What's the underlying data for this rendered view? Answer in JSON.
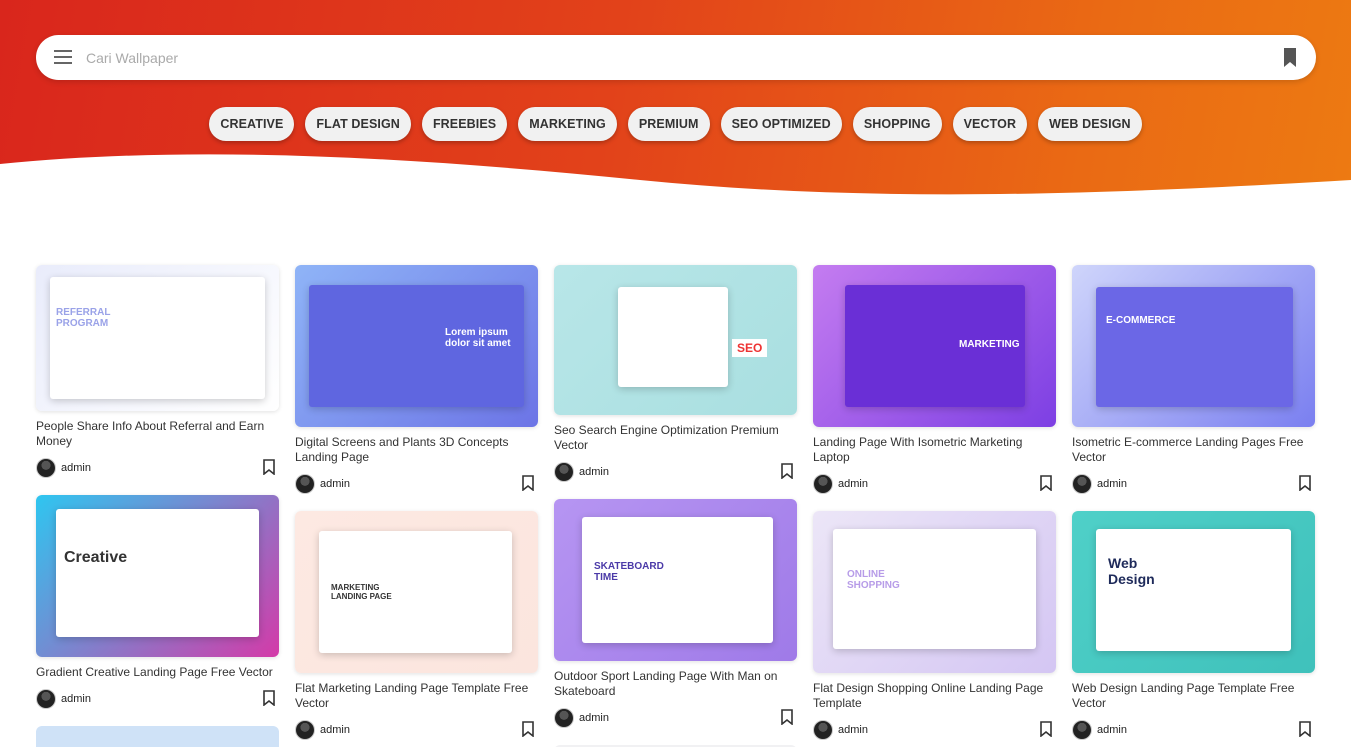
{
  "search": {
    "placeholder": "Cari Wallpaper"
  },
  "tags": [
    "CREATIVE",
    "FLAT DESIGN",
    "FREEBIES",
    "MARKETING",
    "PREMIUM",
    "SEO OPTIMIZED",
    "SHOPPING",
    "VECTOR",
    "WEB DESIGN"
  ],
  "columns": [
    {
      "cards": [
        {
          "title": "People Share Info About Referral and Earn Money",
          "author": "admin",
          "thumb_text": "REFERRAL PROGRAM",
          "colors": [
            "#e9ecfb",
            "#ffffff"
          ]
        },
        {
          "title": "Gradient Creative Landing Page Free Vector",
          "author": "admin",
          "thumb_text": "Creative",
          "colors": [
            "#2ec6f0",
            "#d43aa8"
          ]
        }
      ]
    },
    {
      "cards": [
        {
          "title": "Digital Screens and Plants 3D Concepts Landing Page",
          "author": "admin",
          "thumb_text": "Lorem ipsum dolor sit amet",
          "colors": [
            "#8fb4f7",
            "#6c74e6"
          ]
        },
        {
          "title": "Flat Marketing Landing Page Template Free Vector",
          "author": "admin",
          "thumb_text": "MARKETING LANDING PAGE",
          "colors": [
            "#fde9e2",
            "#fbe5de"
          ]
        }
      ]
    },
    {
      "cards": [
        {
          "title": "Seo Search Engine Optimization Premium Vector",
          "author": "admin",
          "thumb_text": "SEO",
          "colors": [
            "#b8e6e8",
            "#a9dfe0"
          ]
        },
        {
          "title": "Outdoor Sport Landing Page With Man on Skateboard",
          "author": "admin",
          "thumb_text": "SKATEBOARD TIME",
          "colors": [
            "#b695f2",
            "#9f7ae8"
          ]
        }
      ]
    },
    {
      "cards": [
        {
          "title": "Landing Page With Isometric Marketing Laptop",
          "author": "admin",
          "thumb_text": "MARKETING",
          "colors": [
            "#c47cf0",
            "#7d3fe3"
          ]
        },
        {
          "title": "Flat Design Shopping Online Landing Page Template",
          "author": "admin",
          "thumb_text": "ONLINE SHOPPING",
          "colors": [
            "#ece6f7",
            "#d4c6f3"
          ]
        }
      ]
    },
    {
      "cards": [
        {
          "title": "Isometric E-commerce Landing Pages Free Vector",
          "author": "admin",
          "thumb_text": "E-COMMERCE",
          "colors": [
            "#cfd5fb",
            "#7a7ff0"
          ]
        },
        {
          "title": "Web Design Landing Page Template Free Vector",
          "author": "admin",
          "thumb_text": "Web Design",
          "colors": [
            "#4fd0c8",
            "#3fc1bb"
          ]
        }
      ]
    }
  ]
}
